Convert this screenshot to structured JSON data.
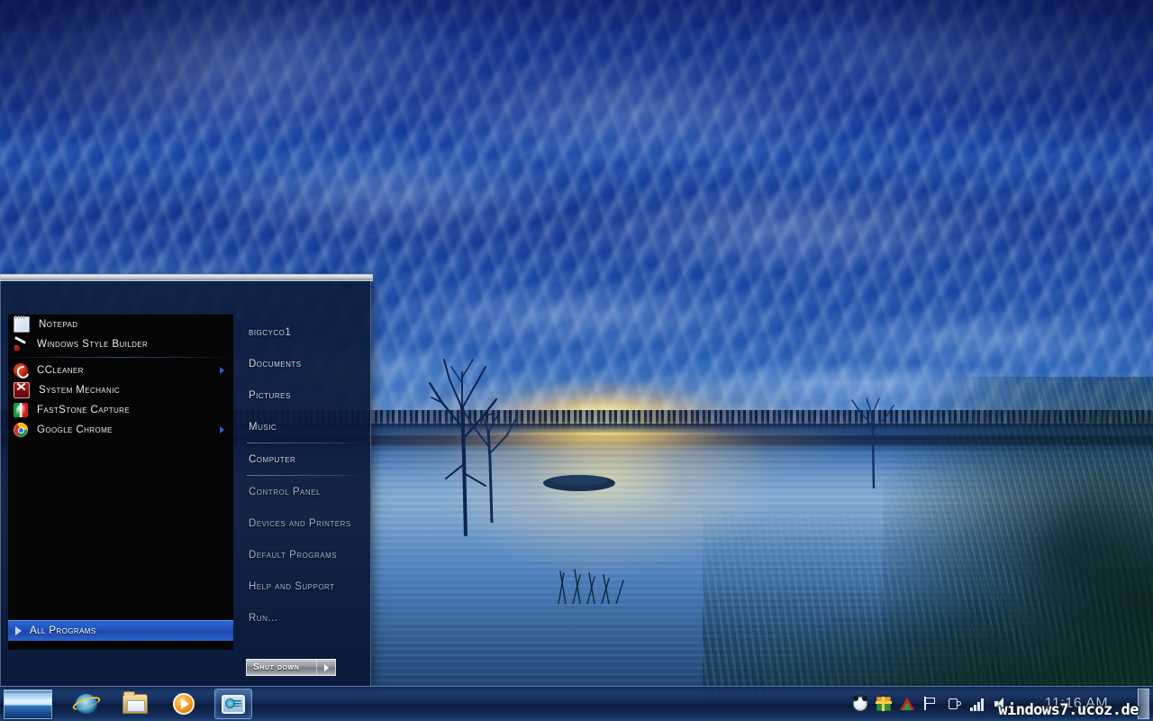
{
  "desktop": {
    "wallpaper_description": "Blue sunset over a lake with reeds and dead trees",
    "colors": {
      "sky_deep_blue": "#0e2a8e",
      "sky_mid_blue": "#14429f",
      "sun_glow": "#fff3b0",
      "water_blue": "#6e9ccb",
      "grass_dark": "#0a221e",
      "taskbar_blue": "#16306e",
      "accent_highlight": "#2d6ad8"
    }
  },
  "start_menu": {
    "programs": [
      {
        "label": "Notepad",
        "icon": "notepad-icon",
        "has_submenu": false
      },
      {
        "label": "Windows Style Builder",
        "icon": "windows-style-builder-icon",
        "has_submenu": false
      },
      {
        "label": "CCleaner",
        "icon": "ccleaner-icon",
        "has_submenu": true
      },
      {
        "label": "System Mechanic",
        "icon": "system-mechanic-icon",
        "has_submenu": false
      },
      {
        "label": "FastStone Capture",
        "icon": "faststone-capture-icon",
        "has_submenu": false
      },
      {
        "label": "Google Chrome",
        "icon": "google-chrome-icon",
        "has_submenu": true
      }
    ],
    "all_programs": {
      "label": "All Programs",
      "icon": "right-triangle-icon"
    },
    "places": [
      {
        "label": "bigcyco1",
        "dim": false,
        "sep_after": false
      },
      {
        "label": "Documents",
        "dim": false,
        "sep_after": false
      },
      {
        "label": "Pictures",
        "dim": false,
        "sep_after": false
      },
      {
        "label": "Music",
        "dim": false,
        "sep_after": true
      },
      {
        "label": "Computer",
        "dim": false,
        "sep_after": true
      },
      {
        "label": "Control Panel",
        "dim": true,
        "sep_after": false
      },
      {
        "label": "Devices and Printers",
        "dim": true,
        "sep_after": false
      },
      {
        "label": "Default Programs",
        "dim": true,
        "sep_after": false
      },
      {
        "label": "Help and Support",
        "dim": true,
        "sep_after": false
      },
      {
        "label": "Run...",
        "dim": true,
        "sep_after": false
      }
    ],
    "shutdown": {
      "label": "Shut down",
      "arrow_icon": "right-triangle-icon"
    }
  },
  "taskbar": {
    "start_button": {
      "name": "start-orb",
      "label": ""
    },
    "quick_launch": [
      {
        "name": "internet-explorer-icon",
        "label": "Internet Explorer",
        "active": false
      },
      {
        "name": "windows-explorer-icon",
        "label": "Windows Explorer",
        "active": false
      },
      {
        "name": "windows-media-player-icon",
        "label": "Windows Media Player",
        "active": false
      },
      {
        "name": "remote-desktop-icon",
        "label": "Remote Desktop",
        "active": true
      }
    ],
    "tray": [
      {
        "name": "panda-antivirus-icon",
        "label": "Panda Antivirus"
      },
      {
        "name": "gift-box-icon",
        "label": "Gift Box"
      },
      {
        "name": "red-triangle-icon",
        "label": "Alert"
      },
      {
        "name": "flag-icon",
        "label": "Action Center"
      },
      {
        "name": "plug-icon",
        "label": "Safely Remove Hardware"
      },
      {
        "name": "signal-bars-icon",
        "label": "Network"
      },
      {
        "name": "volume-icon",
        "label": "Volume"
      }
    ],
    "clock": "11:16 AM",
    "show_desktop_label": "Show desktop"
  },
  "watermark": {
    "text": "windows7.ucoz.de"
  }
}
